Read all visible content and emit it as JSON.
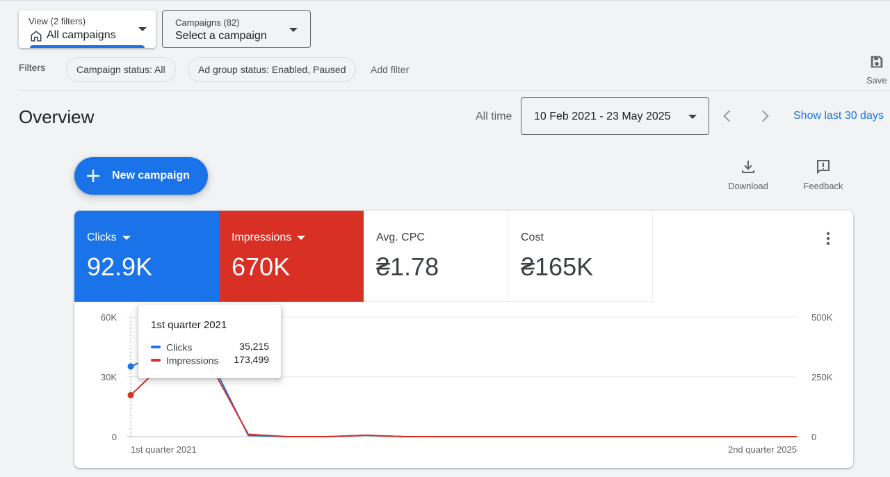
{
  "view_selector": {
    "label": "View (2 filters)",
    "value": "All campaigns"
  },
  "campaign_selector": {
    "label": "Campaigns (82)",
    "value": "Select a campaign"
  },
  "filters": {
    "label": "Filters",
    "chips": [
      "Campaign status: All",
      "Ad group status: Enabled, Paused"
    ],
    "add_filter": "Add filter"
  },
  "save": {
    "label": "Save"
  },
  "overview": {
    "title": "Overview",
    "range_label": "All time",
    "date_range": "10 Feb 2021 - 23 May 2025",
    "show_last": "Show last 30 days"
  },
  "actions": {
    "new_campaign": "New campaign",
    "download": "Download",
    "feedback": "Feedback"
  },
  "metrics": [
    {
      "label": "Clicks",
      "value": "92.9K",
      "color": "#1a73e8"
    },
    {
      "label": "Impressions",
      "value": "670K",
      "color": "#d93025"
    },
    {
      "label": "Avg. CPC",
      "value": "₴1.78"
    },
    {
      "label": "Cost",
      "value": "₴165K"
    }
  ],
  "tooltip": {
    "title": "1st quarter 2021",
    "rows": [
      {
        "label": "Clicks",
        "value": "35,215",
        "color": "#1a73e8"
      },
      {
        "label": "Impressions",
        "value": "173,499",
        "color": "#d93025"
      }
    ]
  },
  "chart_data": {
    "type": "line",
    "x_label_start": "1st quarter 2021",
    "x_label_end": "2nd quarter 2025",
    "left_axis": {
      "ticks": [
        "60K",
        "30K",
        "0"
      ],
      "ylim": [
        0,
        60000
      ]
    },
    "right_axis": {
      "ticks": [
        "500K",
        "250K",
        "0"
      ],
      "ylim": [
        0,
        500000
      ]
    },
    "grid": true,
    "series": [
      {
        "name": "Clicks",
        "color": "#1a73e8",
        "axis": "left",
        "values": [
          35215,
          44000,
          40000,
          600,
          0,
          0,
          700,
          0,
          0,
          0,
          0,
          0,
          0,
          0,
          0,
          0,
          0,
          0
        ]
      },
      {
        "name": "Impressions",
        "color": "#d93025",
        "axis": "right",
        "values": [
          173499,
          330000,
          310000,
          10000,
          0,
          0,
          6000,
          0,
          0,
          0,
          0,
          0,
          0,
          0,
          0,
          0,
          0,
          0
        ]
      }
    ]
  }
}
